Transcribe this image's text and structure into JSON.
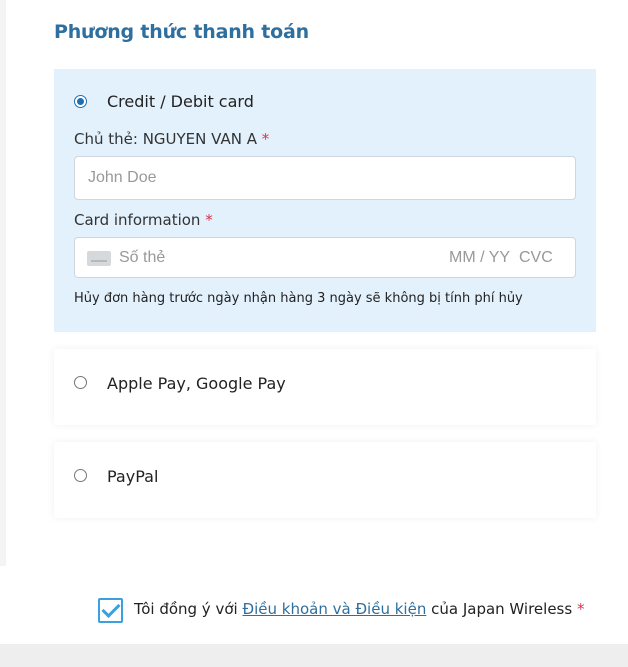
{
  "section_title": "Phương thức thanh toán",
  "payment_options": [
    {
      "label": "Credit / Debit card",
      "selected": true
    },
    {
      "label": "Apple Pay, Google Pay",
      "selected": false
    },
    {
      "label": "PayPal",
      "selected": false
    }
  ],
  "cardholder": {
    "label": "Chủ thẻ: NGUYEN VAN A",
    "required_mark": "*",
    "placeholder": "John Doe"
  },
  "card_info": {
    "label": "Card information",
    "required_mark": "*",
    "number_placeholder": "Số thẻ",
    "expiry_placeholder": "MM / YY",
    "cvc_placeholder": "CVC"
  },
  "cancellation_note": "Hủy đơn hàng trước ngày nhận hàng 3 ngày sẽ không bị tính phí hủy",
  "agreement": {
    "checked": true,
    "prefix": "Tôi đồng ý với",
    "link_text": "Điều khoản và Điều kiện",
    "suffix": "của Japan Wireless",
    "required_mark": "*"
  },
  "colors": {
    "accent": "#2f6f9f",
    "selected_bg": "#e3f1fc",
    "required": "#d9334a",
    "checkbox": "#3aa0e0"
  }
}
